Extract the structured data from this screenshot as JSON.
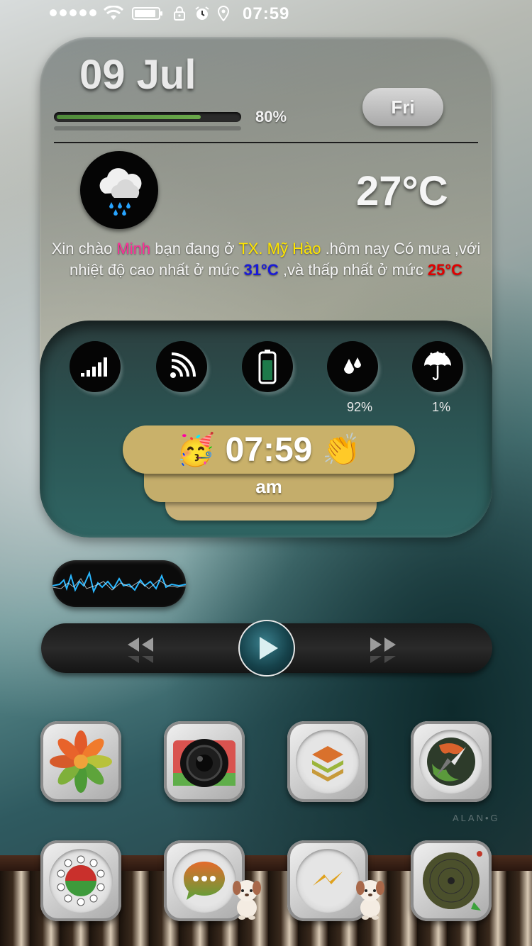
{
  "status_bar": {
    "time": "07:59",
    "icons": [
      "signal-dots-icon",
      "wifi-icon",
      "battery-icon",
      "orientation-lock-icon",
      "alarm-icon",
      "location-icon"
    ]
  },
  "widget": {
    "date": "09 Jul",
    "day": "Fri",
    "progress_percent_label": "80%",
    "progress": 0.8,
    "temperature": "27°C",
    "weather_icon": "rain-cloud-icon",
    "greeting": {
      "p1": "Xin chào ",
      "name": "Minh",
      "p2": " bạn đang ở ",
      "place": "TX. Mỹ Hào",
      "p3": " .hôm nay Có mưa ,với nhiệt độ cao nhất ở mức ",
      "high": "31°C",
      "p4": " ,và thấp nhất ở mức ",
      "low": "25°C"
    },
    "stats": {
      "humidity": "92%",
      "rain_chance": "1%"
    },
    "clock": {
      "time": "07:59",
      "period": "am",
      "emoji_left": "🥳",
      "emoji_right": "👏"
    }
  },
  "watermark": "ALAN•G",
  "colors": {
    "name": "#ff2f9a",
    "place": "#ffe600",
    "high": "#1a1ad8",
    "low": "#e00000",
    "clock_pill": "#c9b16a"
  },
  "apps_row1": [
    "photos-app",
    "camera-app",
    "stack-app",
    "compass-app"
  ],
  "apps_row2": [
    "phone-app",
    "messages-app",
    "messenger-app",
    "radar-app"
  ]
}
